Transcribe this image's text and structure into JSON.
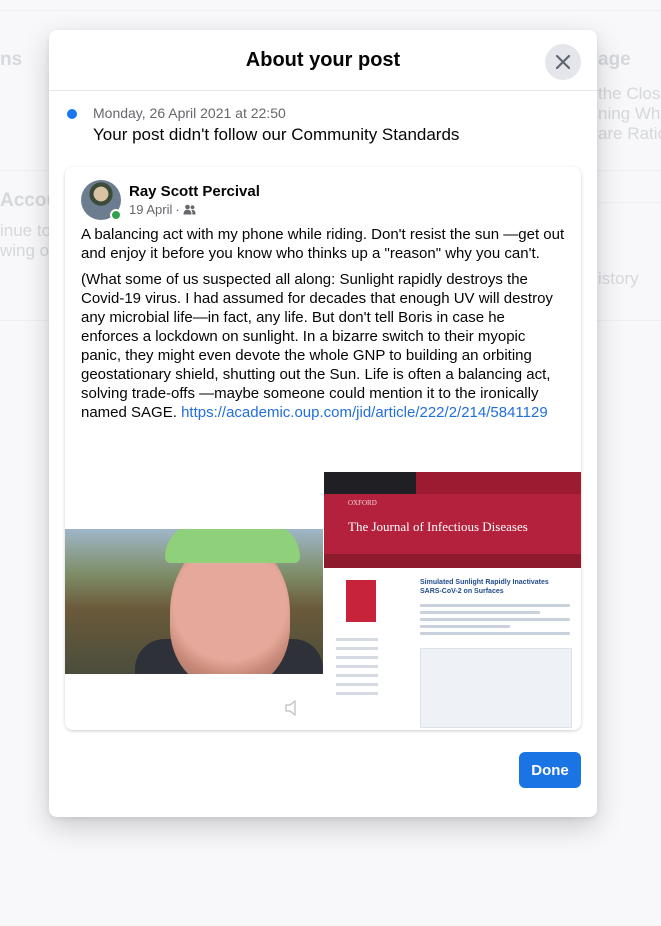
{
  "background": {
    "left_heading": "ns",
    "right_heading": "age",
    "left_heading2": "Accou",
    "left_line1": "inue to",
    "left_line2": "wing ou",
    "right_line1": "the Clos",
    "right_line2": "ning Why",
    "right_line3": "are Ratio",
    "right_line4": "istory"
  },
  "modal": {
    "title": "About your post",
    "close_icon": "close-icon",
    "notice": {
      "date": "Monday, 26 April 2021 at 22:50",
      "message": "Your post didn't follow our Community Standards"
    },
    "post": {
      "author": "Ray Scott Percival",
      "date": "19 April",
      "separator": "·",
      "audience_icon": "friends-icon",
      "paragraph1": "A balancing act with my phone while riding.  Don't resist the sun —get out and enjoy it before you know who thinks up a \"reason\" why you can't.",
      "paragraph2": "(What some of us suspected all along: Sunlight rapidly destroys the Covid-19 virus. I had assumed for decades that enough UV will destroy any microbial life—in fact, any life. But don't tell Boris in case he enforces a lockdown on sunlight. In a bizarre switch to their myopic panic, they might even devote the whole GNP to building an orbiting geostationary shield, shutting out the Sun. Life is often a balancing act, solving trade-offs —maybe someone could mention it to the ironically named SAGE.",
      "link": "https://academic.oup.com/jid/article/222/2/214/5841129",
      "article_image": {
        "publisher": "OXFORD",
        "journal": "The Journal of Infectious Diseases",
        "headline": "Simulated Sunlight Rapidly Inactivates SARS-CoV-2 on Surfaces"
      }
    },
    "done_label": "Done"
  }
}
